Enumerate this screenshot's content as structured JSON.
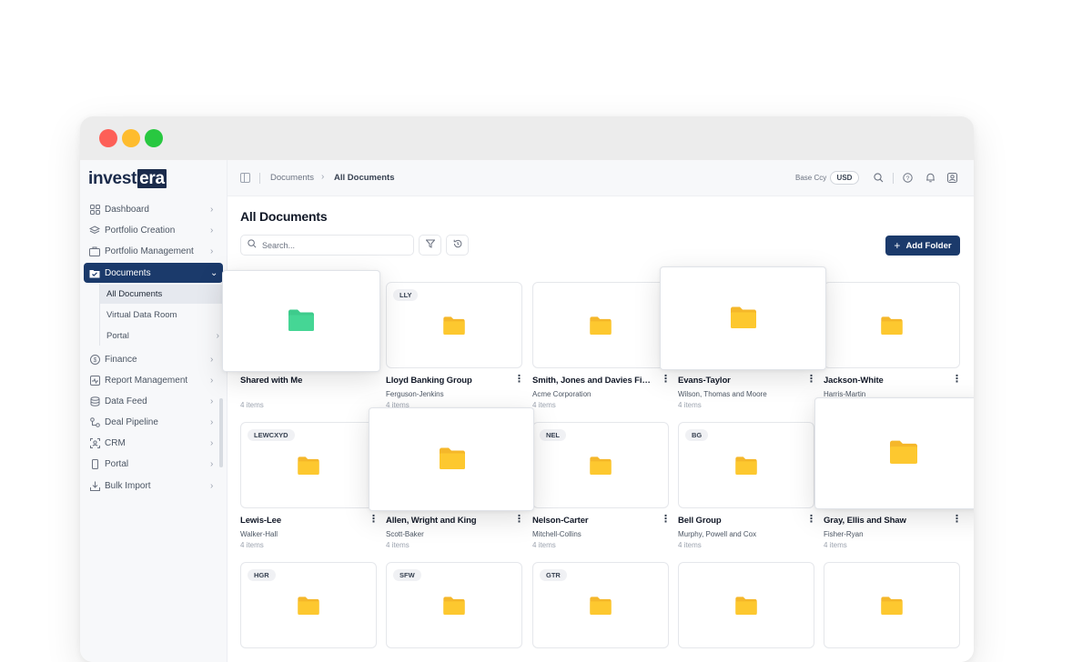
{
  "brand": {
    "name_main": "invest",
    "name_tail": "era"
  },
  "sidebar": {
    "items": [
      {
        "label": "Dashboard",
        "icon": "dashboard-icon"
      },
      {
        "label": "Portfolio Creation",
        "icon": "layers-icon"
      },
      {
        "label": "Portfolio Management",
        "icon": "briefcase-icon"
      },
      {
        "label": "Documents",
        "icon": "folder-check-icon",
        "active": true
      },
      {
        "label": "Finance",
        "icon": "dollar-icon"
      },
      {
        "label": "Report Management",
        "icon": "report-icon"
      },
      {
        "label": "Data Feed",
        "icon": "database-icon"
      },
      {
        "label": "Deal Pipeline",
        "icon": "pipeline-icon"
      },
      {
        "label": "CRM",
        "icon": "crm-icon"
      },
      {
        "label": "Portal",
        "icon": "phone-icon"
      },
      {
        "label": "Bulk Import",
        "icon": "import-icon"
      }
    ],
    "sub_items": [
      {
        "label": "All Documents",
        "selected": true
      },
      {
        "label": "Virtual Data Room"
      },
      {
        "label": "Portal"
      }
    ]
  },
  "topbar": {
    "breadcrumb": [
      "Documents",
      "All Documents"
    ],
    "base_ccy_label": "Base Ccy",
    "currency": "USD"
  },
  "main": {
    "title": "All Documents",
    "search_placeholder": "Search...",
    "add_folder_label": "Add Folder"
  },
  "cards": [
    {
      "name": "Shared with Me",
      "sub": "",
      "count": "4 items",
      "tag": "",
      "color": "#3ecb8c"
    },
    {
      "name": "Lloyd Banking Group",
      "sub": "Ferguson-Jenkins",
      "count": "4 items",
      "tag": "LLY",
      "color": "#fdc82f"
    },
    {
      "name": "Smith, Jones and Davies Fina...",
      "sub": "Acme Corporation",
      "count": "4 items",
      "tag": "",
      "color": "#fdc82f"
    },
    {
      "name": "Evans-Taylor",
      "sub": "Wilson, Thomas and Moore",
      "count": "4 items",
      "tag": "",
      "color": "#fdc82f"
    },
    {
      "name": "Jackson-White",
      "sub": "Harris-Martin",
      "count": "",
      "tag": "",
      "color": "#fdc82f"
    },
    {
      "name": "Lewis-Lee",
      "sub": "Walker-Hall",
      "count": "4 items",
      "tag": "LEWCXYD",
      "color": "#fdc82f"
    },
    {
      "name": "Allen, Wright and King",
      "sub": "Scott-Baker",
      "count": "4 items",
      "tag": "",
      "color": "#fdc82f"
    },
    {
      "name": "Nelson-Carter",
      "sub": "Mitchell-Collins",
      "count": "4 items",
      "tag": "NEL",
      "color": "#fdc82f"
    },
    {
      "name": "Bell Group",
      "sub": "Murphy, Powell and Cox",
      "count": "4 items",
      "tag": "BG",
      "color": "#fdc82f"
    },
    {
      "name": "Gray, Ellis and Shaw",
      "sub": "Fisher-Ryan",
      "count": "4 items",
      "tag": "",
      "color": "#fdc82f"
    },
    {
      "name": "",
      "sub": "",
      "count": "",
      "tag": "HGR",
      "color": "#fdc82f"
    },
    {
      "name": "",
      "sub": "",
      "count": "",
      "tag": "SFW",
      "color": "#fdc82f"
    },
    {
      "name": "",
      "sub": "",
      "count": "",
      "tag": "GTR",
      "color": "#fdc82f"
    },
    {
      "name": "",
      "sub": "",
      "count": "",
      "tag": "",
      "color": "#fdc82f"
    },
    {
      "name": "",
      "sub": "",
      "count": "",
      "tag": "",
      "color": "#fdc82f"
    }
  ],
  "colors": {
    "accent": "#1b3a6b",
    "folder_yellow": "#fdc82f",
    "folder_green": "#3ecb8c"
  }
}
